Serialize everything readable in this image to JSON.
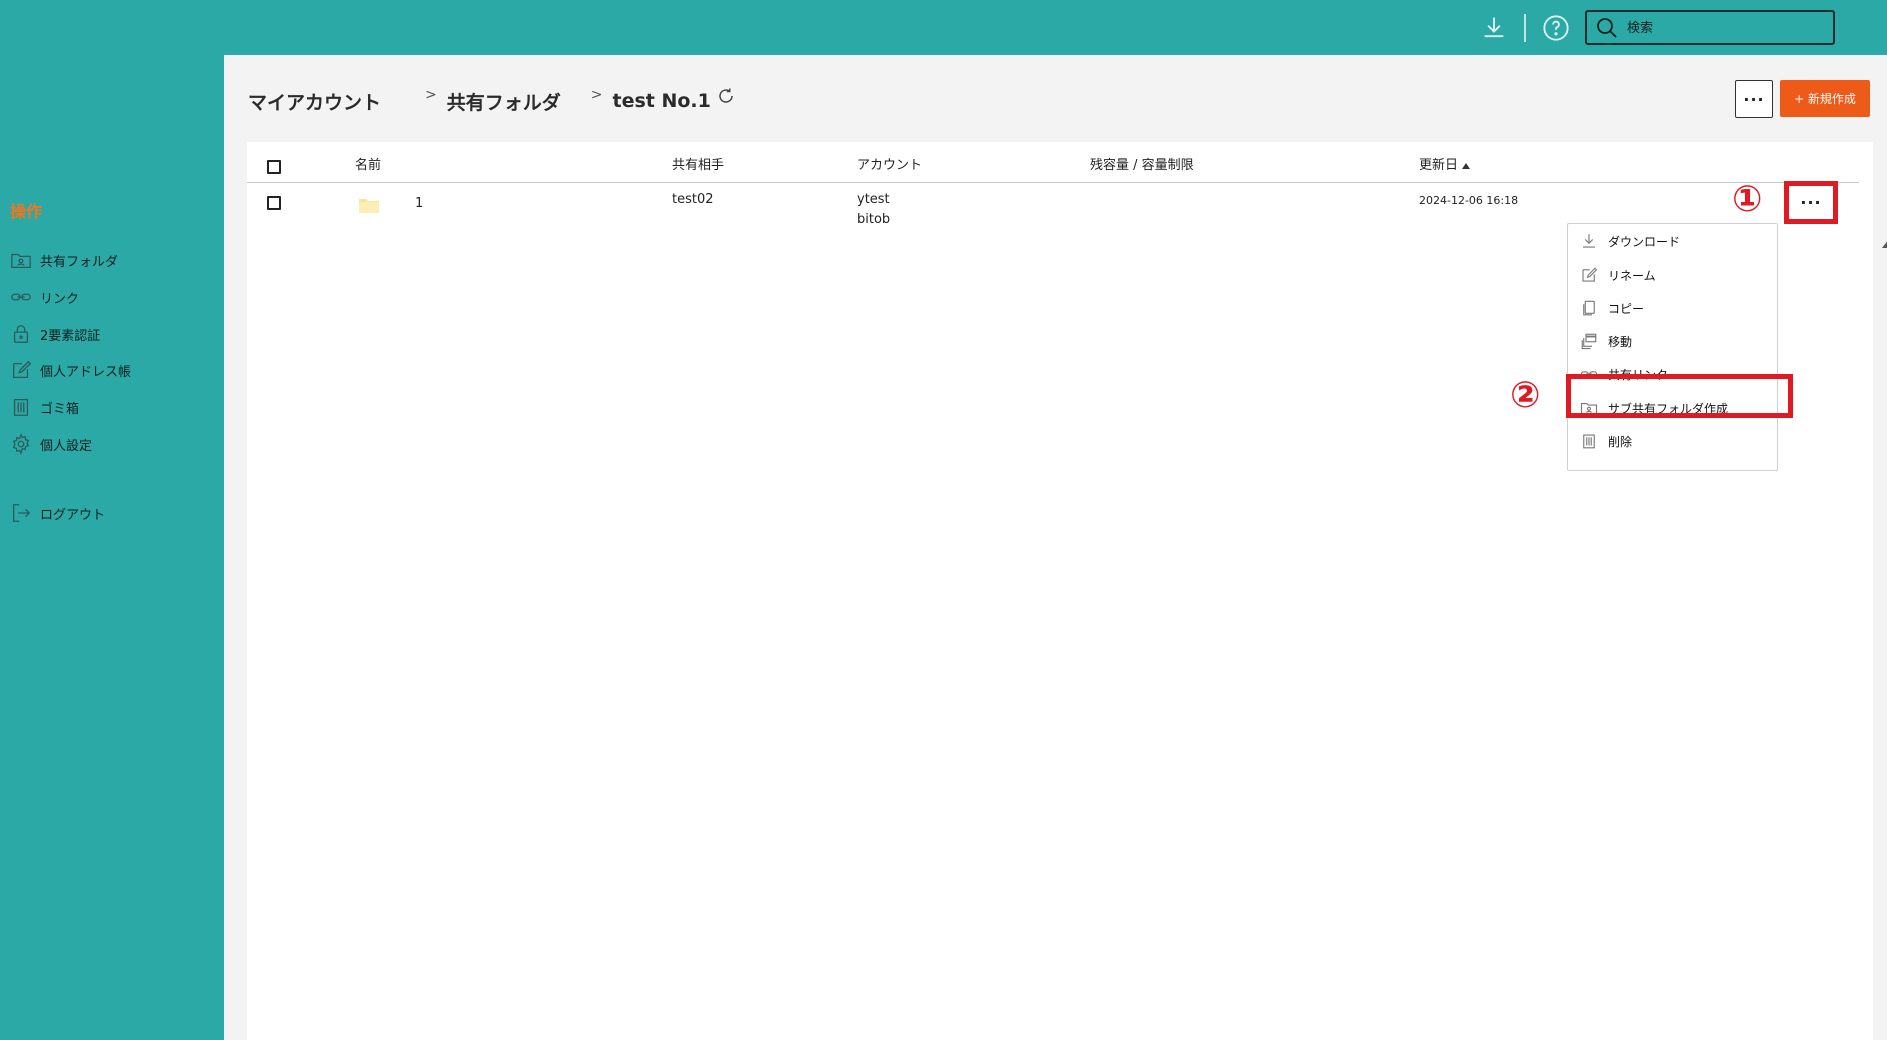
{
  "topbar": {
    "search_placeholder": "検索",
    "icons": [
      "download-icon",
      "help-icon",
      "search-icon"
    ]
  },
  "sidebar": {
    "title": "操作",
    "items": [
      {
        "label": "共有フォルダ",
        "icon": "shared-folder-icon"
      },
      {
        "label": "リンク",
        "icon": "link-icon"
      },
      {
        "label": "2要素認証",
        "icon": "lock-icon"
      },
      {
        "label": "個人アドレス帳",
        "icon": "edit-icon"
      },
      {
        "label": "ゴミ箱",
        "icon": "trash-icon"
      },
      {
        "label": "個人設定",
        "icon": "gear-icon"
      },
      {
        "label": "ログアウト",
        "icon": "logout-icon"
      }
    ]
  },
  "breadcrumb": {
    "items": [
      "マイアカウント",
      "共有フォルダ",
      "test No.1"
    ],
    "separator": ">"
  },
  "toolbar": {
    "more_label": "···",
    "new_label": "+ 新規作成"
  },
  "table": {
    "headers": {
      "name": "名前",
      "shared_with": "共有相手",
      "account": "アカウント",
      "quota": "残容量 / 容量制限",
      "updated": "更新日"
    },
    "rows": [
      {
        "name": "1",
        "shared_with": "test02",
        "account_line1": "ytest",
        "account_line2": "bitob",
        "quota": "",
        "updated": "2024-12-06 16:18",
        "more_label": "···"
      }
    ]
  },
  "context_menu": {
    "items": [
      {
        "label": "ダウンロード",
        "icon": "download-icon"
      },
      {
        "label": "リネーム",
        "icon": "edit-icon"
      },
      {
        "label": "コピー",
        "icon": "copy-icon"
      },
      {
        "label": "移動",
        "icon": "move-icon"
      },
      {
        "label": "共有リンク",
        "icon": "link-icon"
      },
      {
        "label": "サブ共有フォルダ作成",
        "icon": "shared-folder-icon"
      },
      {
        "label": "削除",
        "icon": "trash-icon"
      }
    ]
  },
  "annotations": {
    "callout1": "①",
    "callout2": "②",
    "color": "#e01a22"
  },
  "colors": {
    "brand": "#2aa9a7",
    "accent": "#ee5a17",
    "sidebar_title": "#f2761d"
  }
}
